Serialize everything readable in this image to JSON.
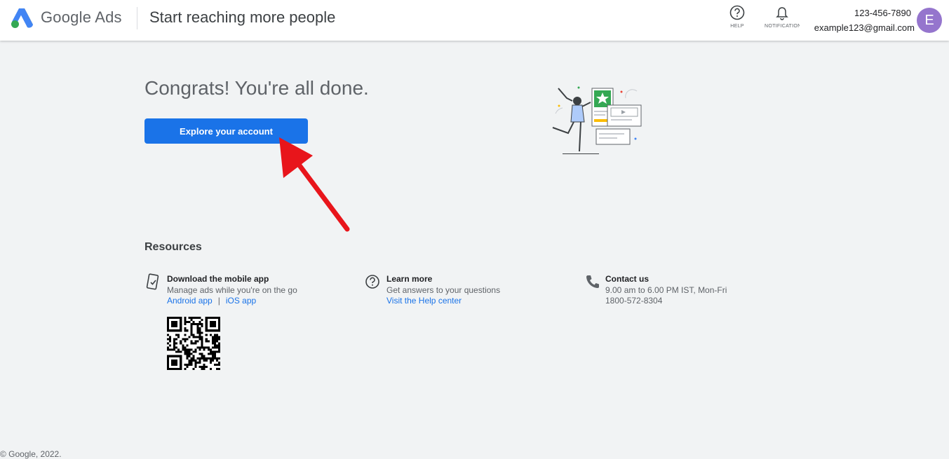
{
  "header": {
    "brand": "Google Ads",
    "page_title": "Start reaching more people",
    "help_label": "HELP",
    "notifications_label": "NOTIFICATIONS",
    "account_phone": "123-456-7890",
    "account_email": "example123@gmail.com",
    "avatar_initial": "E"
  },
  "main": {
    "heading": "Congrats! You're all done.",
    "primary_button": "Explore your account"
  },
  "resources": {
    "heading": "Resources",
    "mobile": {
      "title": "Download the mobile app",
      "description": "Manage ads while you're on the go",
      "android_link": "Android app",
      "separator": "|",
      "ios_link": "iOS app"
    },
    "learn": {
      "title": "Learn more",
      "description": "Get answers to your questions",
      "link": "Visit the Help center"
    },
    "contact": {
      "title": "Contact us",
      "hours": "9.00 am to 6.00 PM IST, Mon-Fri",
      "phone": "1800-572-8304"
    }
  },
  "footer": {
    "copyright": "© Google, 2022."
  },
  "colors": {
    "primary": "#1a73e8",
    "background": "#f1f3f4",
    "avatar": "#9575cd",
    "annotation_arrow": "#e8151b"
  },
  "icons": [
    "google-ads-logo-icon",
    "help-icon",
    "bell-icon",
    "phone-device-icon",
    "help-circle-icon",
    "phone-call-icon",
    "qr-code-icon"
  ]
}
